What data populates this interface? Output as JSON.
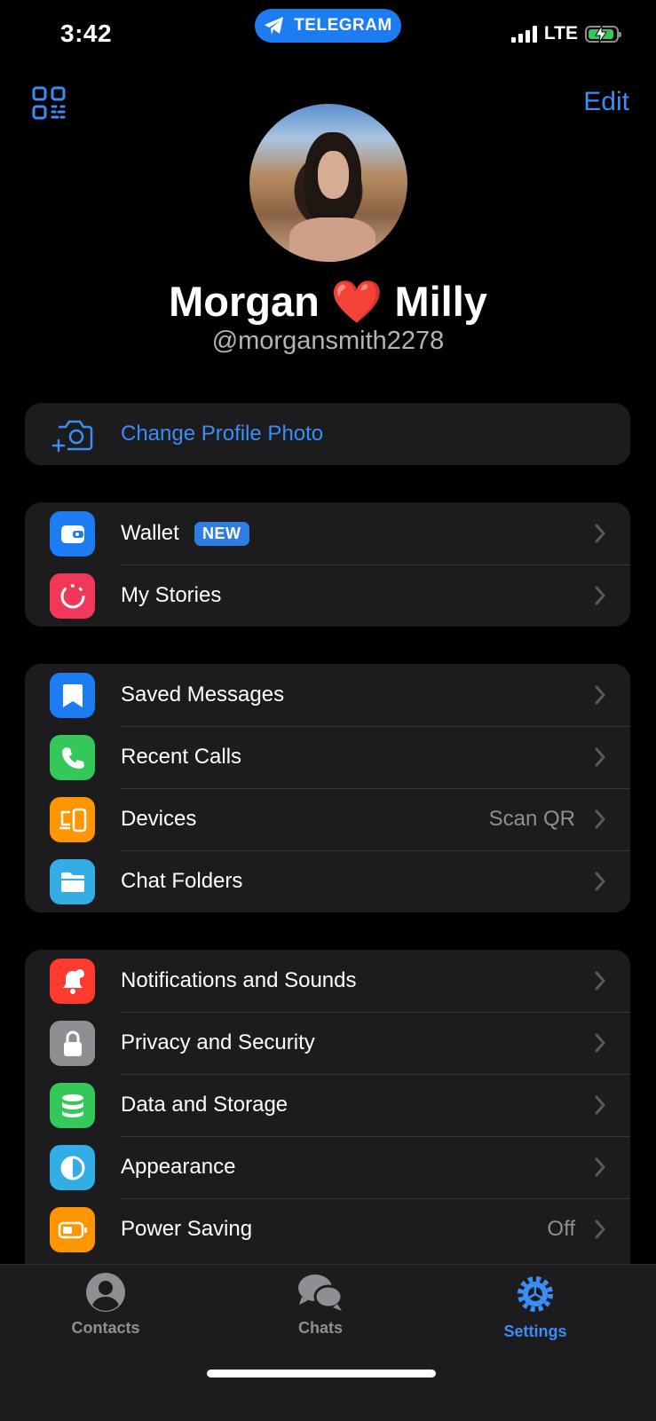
{
  "status_bar": {
    "time": "3:42",
    "app_pill_label": "TELEGRAM",
    "network": "LTE"
  },
  "header": {
    "edit_label": "Edit",
    "profile_name": "Morgan ❤️ Milly",
    "profile_subtitle": "@morgansmith2278"
  },
  "photo_group": {
    "change_photo_label": "Change Profile Photo"
  },
  "group1": [
    {
      "label": "Wallet",
      "badge": "NEW",
      "icon": "wallet-icon",
      "color": "#1e7cf2"
    },
    {
      "label": "My Stories",
      "icon": "stories-icon",
      "color": "#f2385a"
    }
  ],
  "group2": [
    {
      "label": "Saved Messages",
      "icon": "bookmark-icon",
      "color": "#1e7cf2"
    },
    {
      "label": "Recent Calls",
      "icon": "phone-icon",
      "color": "#34c759"
    },
    {
      "label": "Devices",
      "value": "Scan QR",
      "icon": "devices-icon",
      "color": "#ff9500"
    },
    {
      "label": "Chat Folders",
      "icon": "folder-icon",
      "color": "#32ade6"
    }
  ],
  "group3": [
    {
      "label": "Notifications and Sounds",
      "icon": "bell-icon",
      "color": "#ff3b30"
    },
    {
      "label": "Privacy and Security",
      "icon": "lock-icon",
      "color": "#8e8e93"
    },
    {
      "label": "Data and Storage",
      "icon": "database-icon",
      "color": "#34c759"
    },
    {
      "label": "Appearance",
      "icon": "half-circle-icon",
      "color": "#32ade6"
    },
    {
      "label": "Power Saving",
      "value": "Off",
      "icon": "battery-icon",
      "color": "#ff9500"
    }
  ],
  "tab_bar": {
    "contacts": "Contacts",
    "chats": "Chats",
    "settings": "Settings",
    "active_color": "#3a8ef5",
    "inactive_color": "#8e8e93"
  }
}
